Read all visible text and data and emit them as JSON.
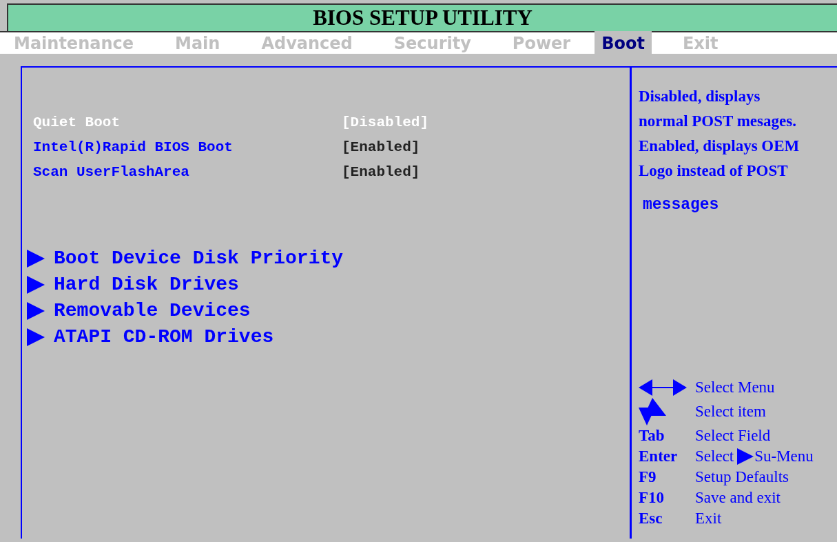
{
  "title": "BIOS SETUP UTILITY",
  "tabs": [
    {
      "label": "Maintenance",
      "selected": false
    },
    {
      "label": "Main",
      "selected": false
    },
    {
      "label": "Advanced",
      "selected": false
    },
    {
      "label": "Security",
      "selected": false
    },
    {
      "label": "Power",
      "selected": false
    },
    {
      "label": "Boot",
      "selected": true
    },
    {
      "label": "Exit",
      "selected": false
    }
  ],
  "settings": [
    {
      "label": "Quiet Boot",
      "value": "[Disabled]",
      "selected": true
    },
    {
      "label": "Intel(R)Rapid BIOS Boot",
      "value": "[Enabled]",
      "selected": false
    },
    {
      "label": "Scan UserFlashArea",
      "value": "[Enabled]",
      "selected": false
    }
  ],
  "submenus": [
    "Boot Device Disk Priority",
    "Hard Disk Drives",
    "Removable Devices",
    "ATAPI CD-ROM Drives"
  ],
  "help": [
    {
      "kind": "serif",
      "text": "Disabled, displays"
    },
    {
      "kind": "serif",
      "text": "normal POST mesages."
    },
    {
      "kind": "serif",
      "text": "Enabled, displays OEM"
    },
    {
      "kind": "serif",
      "text": "Logo instead  of  POST"
    },
    {
      "kind": "mono",
      "text": "messages"
    }
  ],
  "legend": [
    {
      "kind": "arrows-lr",
      "action": "Select Menu"
    },
    {
      "kind": "arrows-ud",
      "action": "Select item"
    },
    {
      "kind": "key",
      "key": "Tab",
      "action": "Select Field"
    },
    {
      "kind": "key-submenu",
      "key": "Enter",
      "action": "Select",
      "suffix": "Su-Menu"
    },
    {
      "kind": "key",
      "key": "F9",
      "action": "Setup  Defaults"
    },
    {
      "kind": "key",
      "key": "F10",
      "action": "Save and exit"
    },
    {
      "kind": "key",
      "key": "Esc",
      "action": "Exit"
    }
  ]
}
